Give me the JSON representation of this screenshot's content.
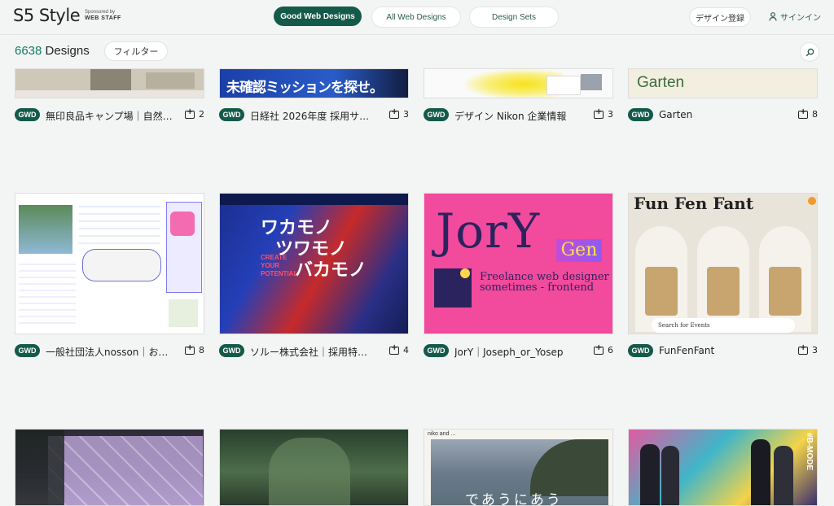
{
  "header": {
    "logo": "S5 Style",
    "sponsor_label": "Sponsored by",
    "sponsor_name": "WEB STAFF",
    "tabs": [
      {
        "label": "Good Web Designs",
        "active": true
      },
      {
        "label": "All Web Designs",
        "active": false
      },
      {
        "label": "Design Sets",
        "active": false
      }
    ],
    "register_label": "デザイン登録",
    "signin_label": "サインイン"
  },
  "subbar": {
    "count": "6638",
    "count_label": "Designs",
    "filter_label": "フィルター"
  },
  "colors": {
    "accent": "#145a4b",
    "count_green": "#147a63"
  },
  "cards": [
    {
      "badge": "GWD",
      "title": "無印良品キャンプ場｜自然…",
      "count": "2"
    },
    {
      "badge": "GWD",
      "title": "日経社 2026年度 採用サ…",
      "count": "3",
      "thumb_text": "未確認ミッションを探せ。"
    },
    {
      "badge": "GWD",
      "title": "デザイン Nikon 企業情報",
      "count": "3"
    },
    {
      "badge": "GWD",
      "title": "Garten",
      "count": "8",
      "thumb_text": "Garten"
    },
    {
      "badge": "GWD",
      "title": "一般社団法人nosson｜お…",
      "count": "8"
    },
    {
      "badge": "GWD",
      "title": "ソルー株式会社｜採用特…",
      "count": "4",
      "thumb_text": [
        "ワカモノ",
        "ツワモノ",
        "バカモノ"
      ],
      "thumb_sub": [
        "CREATE",
        "YOUR",
        "POTENTIAL"
      ]
    },
    {
      "badge": "GWD",
      "title": "JorY｜Joseph_or_Yosep",
      "count": "6",
      "thumb_text": "JorY",
      "thumb_tag": "Gen",
      "thumb_sub": [
        "Freelance web designer",
        "sometimes - frontend"
      ]
    },
    {
      "badge": "GWD",
      "title": "FunFenFant",
      "count": "3",
      "thumb_text": "Fun Fen Fant",
      "thumb_sub": "Search for Events"
    },
    {
      "badge": "",
      "title": "",
      "count": ""
    },
    {
      "badge": "",
      "title": "",
      "count": ""
    },
    {
      "badge": "",
      "title": "",
      "count": "",
      "thumb_text": "であうにあう",
      "thumb_sub": "niko and ..."
    },
    {
      "badge": "",
      "title": "",
      "count": "",
      "thumb_text": "#B-MODE"
    }
  ]
}
